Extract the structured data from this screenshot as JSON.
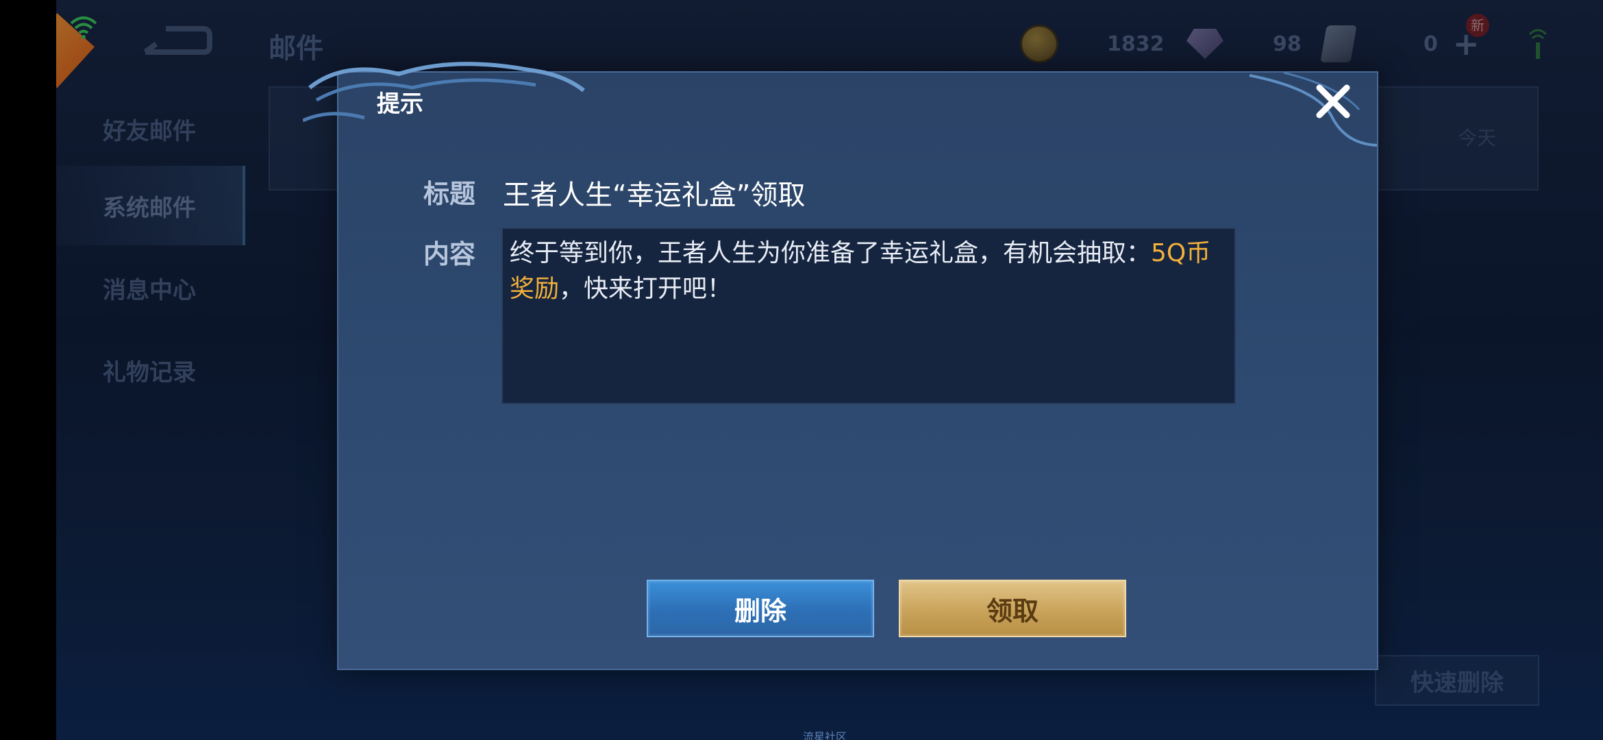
{
  "header": {
    "title": "邮件",
    "currencies": [
      {
        "icon": "gold-coin-icon",
        "value": "1832"
      },
      {
        "icon": "diamond-icon",
        "value": "98"
      },
      {
        "icon": "voucher-icon",
        "value": "0"
      }
    ],
    "new_badge": "新"
  },
  "sidebar": {
    "items": [
      {
        "label": "好友邮件",
        "active": false
      },
      {
        "label": "系统邮件",
        "active": true
      },
      {
        "label": "消息中心",
        "active": false
      },
      {
        "label": "礼物记录",
        "active": false
      }
    ]
  },
  "mail_list": {
    "date": "今天",
    "quick_delete_label": "快速删除"
  },
  "dialog": {
    "title": "提示",
    "subject_label": "标题",
    "subject": "王者人生“幸运礼盒”领取",
    "content_label": "内容",
    "content_part1": "终于等到你，王者人生为你准备了幸运礼盒，有机会抽取：",
    "content_highlight": "5Q币奖励",
    "content_part2": "，快来打开吧！",
    "delete_label": "删除",
    "claim_label": "领取"
  },
  "watermark": "流星社区",
  "colors": {
    "highlight": "#f2b13a",
    "delete_button": "#2d6fb6",
    "claim_button": "#c9a35a"
  }
}
